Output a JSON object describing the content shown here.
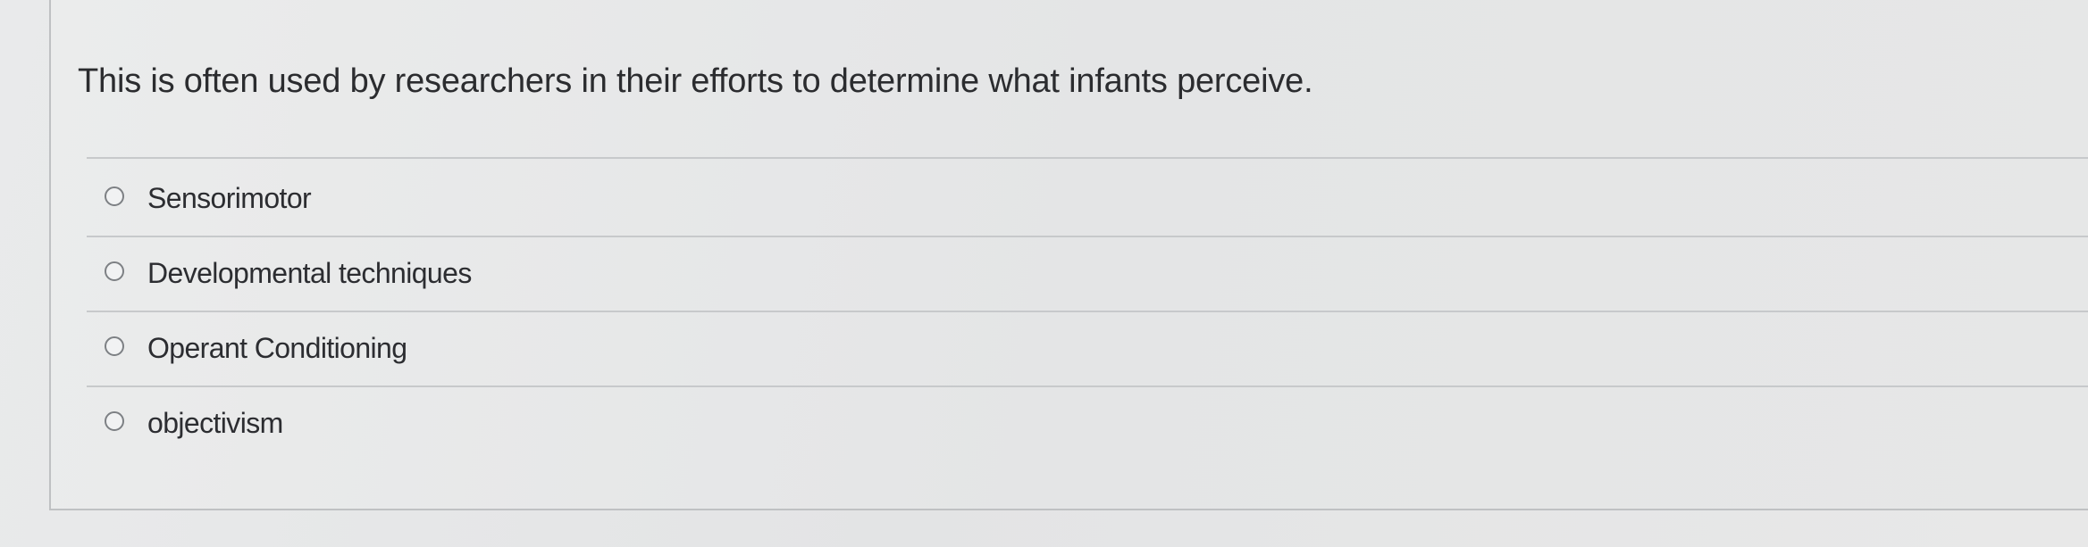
{
  "question": {
    "text": "This is often used by researchers in their efforts to determine what infants perceive."
  },
  "choices": [
    {
      "label": "Sensorimotor",
      "selected": false
    },
    {
      "label": "Developmental techniques",
      "selected": false
    },
    {
      "label": "Operant Conditioning",
      "selected": false
    },
    {
      "label": "objectivism",
      "selected": false
    }
  ],
  "colors": {
    "background": "#e6e7e8",
    "text": "#2b2c2f",
    "divider": "#c7c9cb",
    "radio_border": "#7d8084"
  }
}
